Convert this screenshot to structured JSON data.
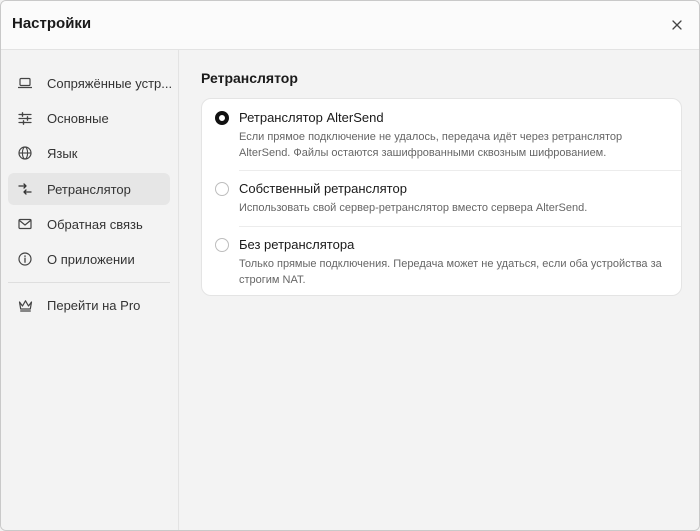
{
  "window": {
    "title": "Настройки"
  },
  "sidebar": {
    "items": [
      {
        "label": "Сопряжённые устр...",
        "icon": "laptop-icon",
        "active": false
      },
      {
        "label": "Основные",
        "icon": "sliders-icon",
        "active": false
      },
      {
        "label": "Язык",
        "icon": "globe-icon",
        "active": false
      },
      {
        "label": "Ретранслятор",
        "icon": "relay-icon",
        "active": true
      },
      {
        "label": "Обратная связь",
        "icon": "mail-icon",
        "active": false
      },
      {
        "label": "О приложении",
        "icon": "info-icon",
        "active": false
      }
    ],
    "pro": {
      "label": "Перейти на Pro",
      "icon": "crown-icon"
    }
  },
  "main": {
    "section_title": "Ретранслятор",
    "options": [
      {
        "title": "Ретранслятор AlterSend",
        "description": "Если прямое подключение не удалось, передача идёт через ретранслятор AlterSend. Файлы остаются зашифрованными сквозным шифрованием.",
        "selected": true
      },
      {
        "title": "Собственный ретранслятор",
        "description": "Использовать свой сервер-ретранслятор вместо сервера AlterSend.",
        "selected": false
      },
      {
        "title": "Без ретранслятора",
        "description": "Только прямые подключения. Передача может не удаться, если оба устройства за строгим NAT.",
        "selected": false
      }
    ]
  },
  "colors": {
    "background": "#f3f3f3",
    "card": "#ffffff",
    "active_nav": "#e6e6e6",
    "radio_selected": "#111111"
  }
}
